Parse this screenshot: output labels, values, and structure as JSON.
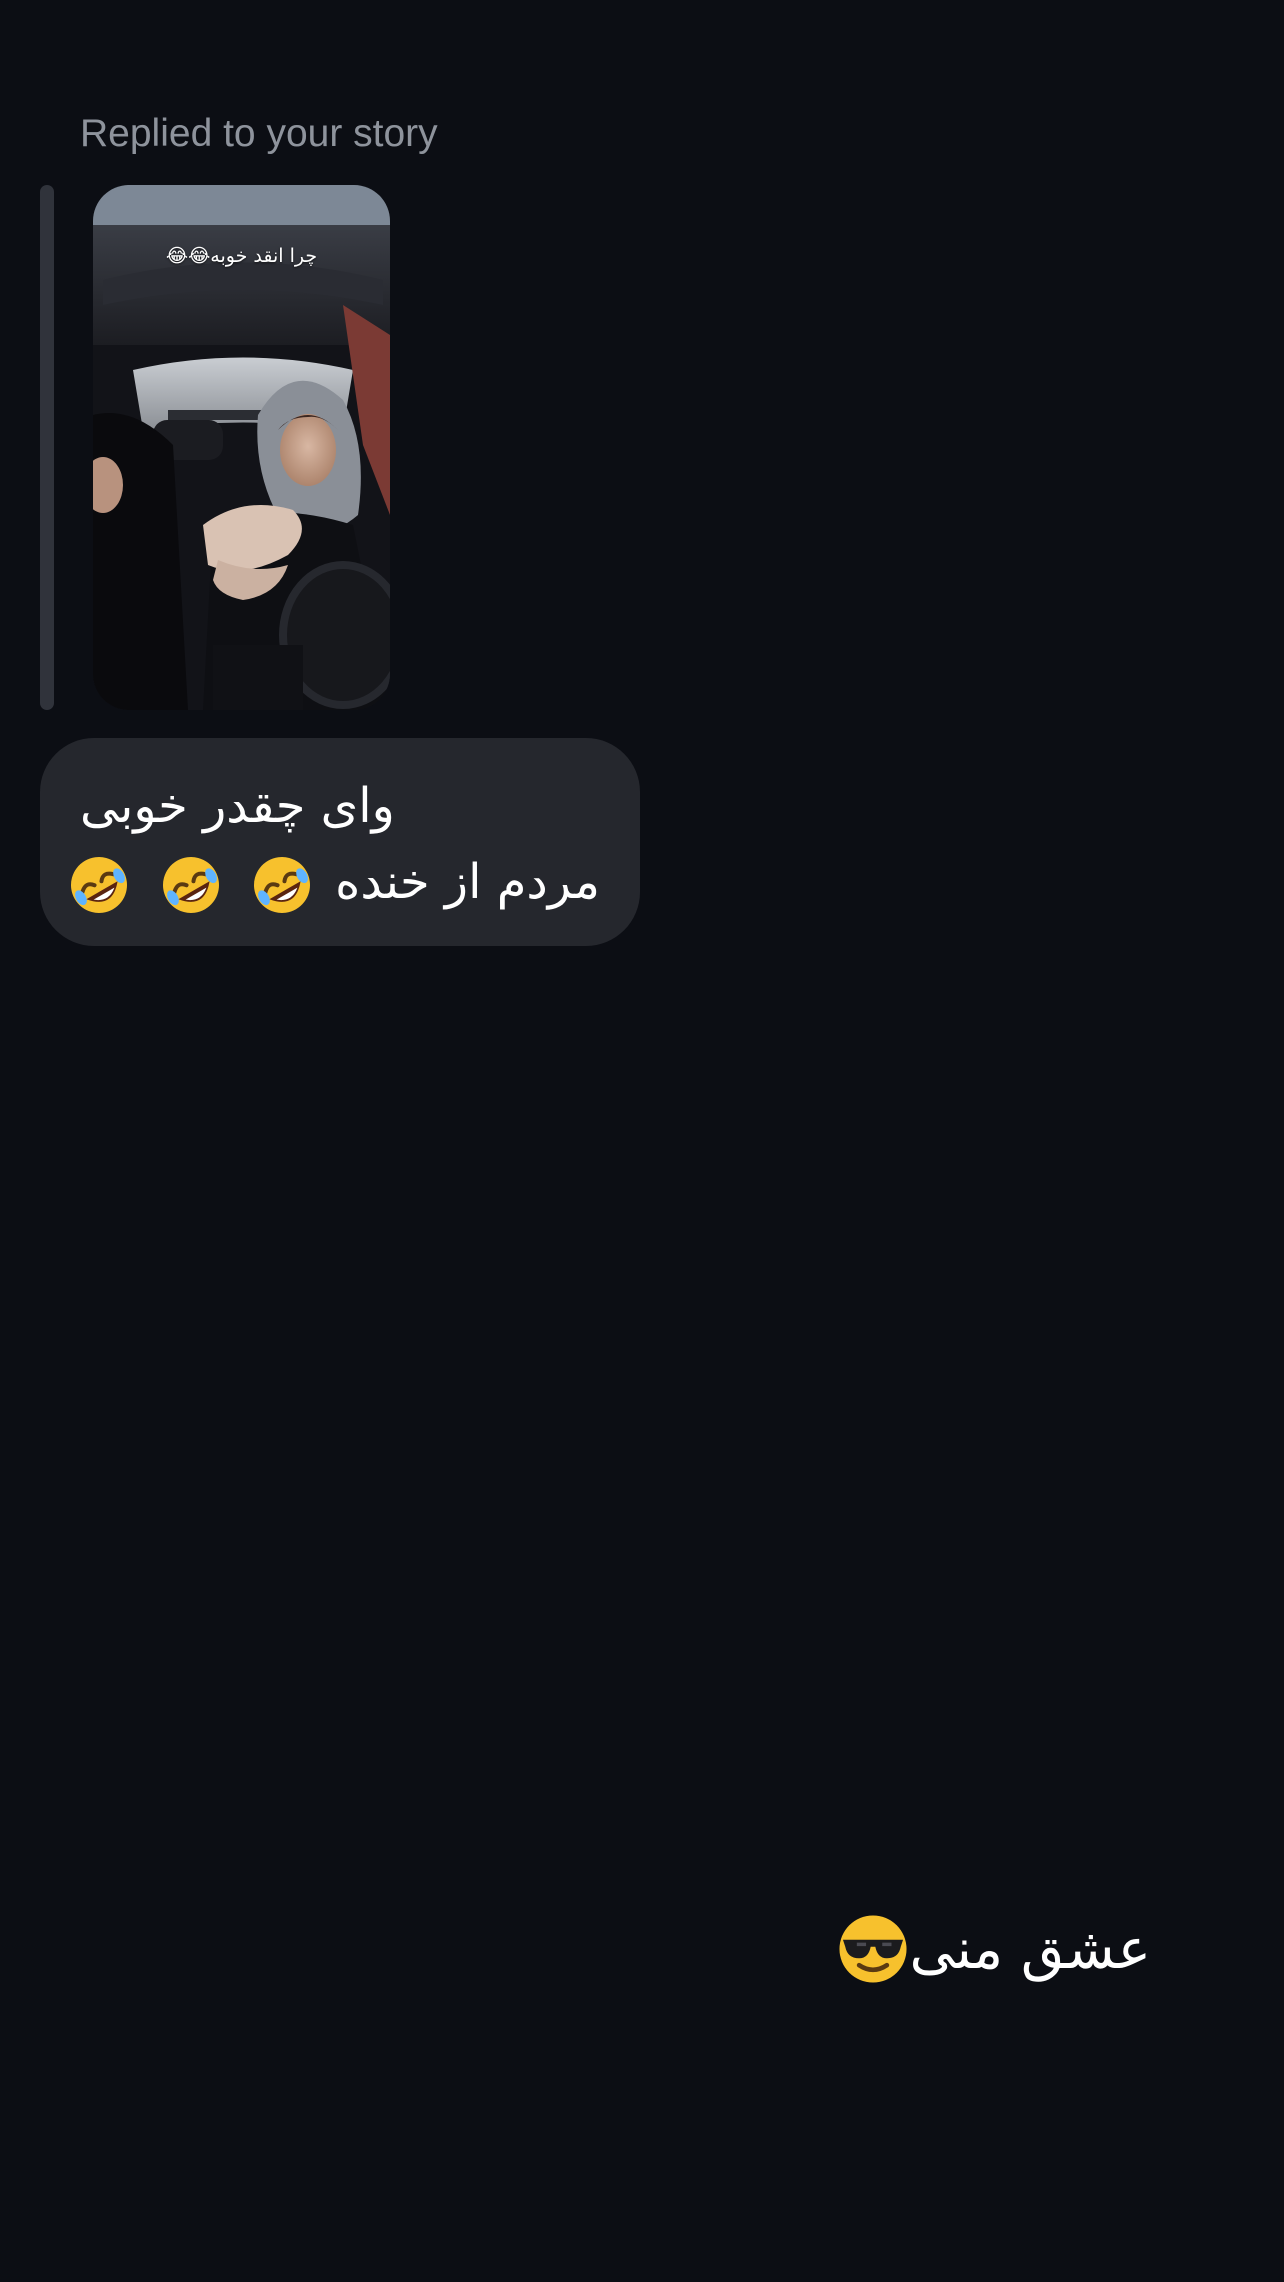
{
  "story_reply": {
    "label": "Replied to your story",
    "story_caption": "چرا انقد خوبه😂😂"
  },
  "received_message": {
    "line1": "وای چقدر خوبی",
    "line2": "مردم از خنده",
    "emojis": [
      "rolling-on-floor-laughing-emoji",
      "rolling-on-floor-laughing-emoji",
      "rolling-on-floor-laughing-emoji"
    ]
  },
  "sent_message": {
    "text": "عشق منی",
    "emoji": "smiling-face-with-sunglasses-emoji"
  },
  "colors": {
    "background": "#0c0e14",
    "bubble_received": "#25272d",
    "label_gray": "#8e939c",
    "reply_bar": "#30333b"
  }
}
